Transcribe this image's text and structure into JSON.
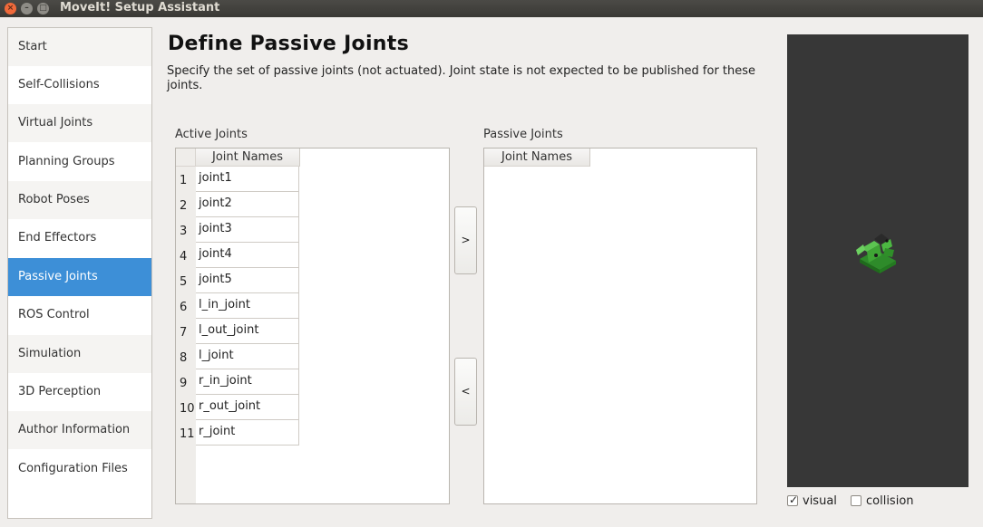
{
  "window": {
    "title": "MoveIt! Setup Assistant",
    "close_glyph": "×",
    "min_glyph": "–",
    "max_glyph": "□"
  },
  "sidebar": {
    "items": [
      {
        "label": "Start"
      },
      {
        "label": "Self-Collisions"
      },
      {
        "label": "Virtual Joints"
      },
      {
        "label": "Planning Groups"
      },
      {
        "label": "Robot Poses"
      },
      {
        "label": "End Effectors"
      },
      {
        "label": "Passive Joints"
      },
      {
        "label": "ROS Control"
      },
      {
        "label": "Simulation"
      },
      {
        "label": "3D Perception"
      },
      {
        "label": "Author Information"
      },
      {
        "label": "Configuration Files"
      }
    ],
    "active_index": 6
  },
  "page": {
    "title": "Define Passive Joints",
    "description": "Specify the set of passive joints (not actuated). Joint state is not expected to be published for these joints."
  },
  "active_joints": {
    "label": "Active Joints",
    "column_header": "Joint Names",
    "rows": [
      {
        "num": "1",
        "name": "joint1"
      },
      {
        "num": "2",
        "name": "joint2"
      },
      {
        "num": "3",
        "name": "joint3"
      },
      {
        "num": "4",
        "name": "joint4"
      },
      {
        "num": "5",
        "name": "joint5"
      },
      {
        "num": "6",
        "name": "l_in_joint"
      },
      {
        "num": "7",
        "name": "l_out_joint"
      },
      {
        "num": "8",
        "name": "l_joint"
      },
      {
        "num": "9",
        "name": "r_in_joint"
      },
      {
        "num": "10",
        "name": "r_out_joint"
      },
      {
        "num": "11",
        "name": "r_joint"
      }
    ]
  },
  "passive_joints": {
    "label": "Passive Joints",
    "column_header": "Joint Names",
    "rows": []
  },
  "buttons": {
    "move_to_passive": ">",
    "move_to_active": "<"
  },
  "viewer": {
    "visual_label": "visual",
    "visual_checked": true,
    "collision_label": "collision",
    "collision_checked": false,
    "check_glyph": "✓",
    "background": "#373737",
    "robot_color": "#3fa535"
  },
  "colors": {
    "accent": "#3d8fd7"
  }
}
